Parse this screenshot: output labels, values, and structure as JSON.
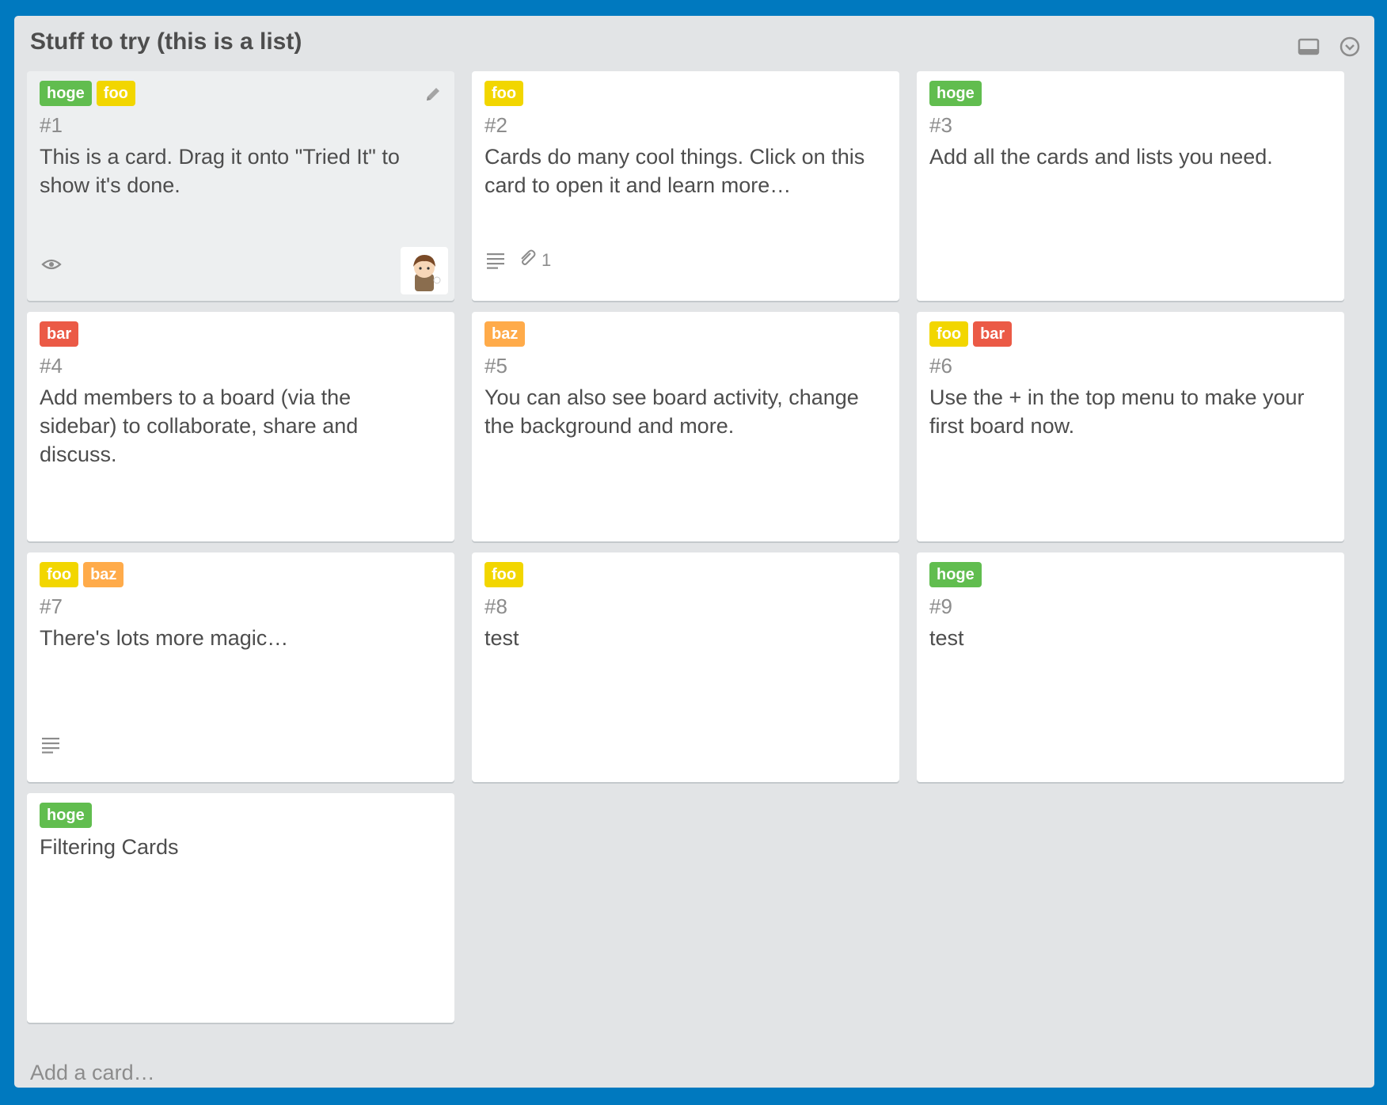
{
  "list": {
    "title": "Stuff to try (this is a list)",
    "add_card": "Add a card…"
  },
  "colors": {
    "board_bg": "#0079bf",
    "list_bg": "#e2e4e6",
    "green": "#61bd4f",
    "yellow": "#f2d600",
    "orange": "#ffab4a",
    "red": "#eb5a46"
  },
  "cards": [
    {
      "num": "#1",
      "title": "This is a card. Drag it onto \"Tried It\" to show it's done.",
      "labels": [
        {
          "text": "hoge",
          "color": "green"
        },
        {
          "text": "foo",
          "color": "yellow"
        }
      ]
    },
    {
      "num": "#2",
      "title": "Cards do many cool things. Click on this card to open it and learn more…",
      "labels": [
        {
          "text": "foo",
          "color": "yellow"
        }
      ],
      "attachments": "1"
    },
    {
      "num": "#3",
      "title": "Add all the cards and lists you need.",
      "labels": [
        {
          "text": "hoge",
          "color": "green"
        }
      ]
    },
    {
      "num": "#4",
      "title": "Add members to a board (via the sidebar) to collaborate, share and discuss.",
      "labels": [
        {
          "text": "bar",
          "color": "red"
        }
      ]
    },
    {
      "num": "#5",
      "title": "You can also see board activity, change the background and more.",
      "labels": [
        {
          "text": "baz",
          "color": "orange"
        }
      ]
    },
    {
      "num": "#6",
      "title": "Use the + in the top menu to make your first board now.",
      "labels": [
        {
          "text": "foo",
          "color": "yellow"
        },
        {
          "text": "bar",
          "color": "red"
        }
      ]
    },
    {
      "num": "#7",
      "title": "There's lots more magic…",
      "labels": [
        {
          "text": "foo",
          "color": "yellow"
        },
        {
          "text": "baz",
          "color": "orange"
        }
      ]
    },
    {
      "num": "#8",
      "title": "test",
      "labels": [
        {
          "text": "foo",
          "color": "yellow"
        }
      ]
    },
    {
      "num": "#9",
      "title": "test",
      "labels": [
        {
          "text": "hoge",
          "color": "green"
        }
      ]
    },
    {
      "title": "Filtering Cards",
      "labels": [
        {
          "text": "hoge",
          "color": "green"
        }
      ]
    }
  ],
  "icons": {
    "card_view": "card-view-icon",
    "list_menu": "chevron-down-circle-icon",
    "edit": "pencil-icon",
    "watch": "eye-icon",
    "description": "description-lines-icon",
    "attachment": "paperclip-icon"
  }
}
